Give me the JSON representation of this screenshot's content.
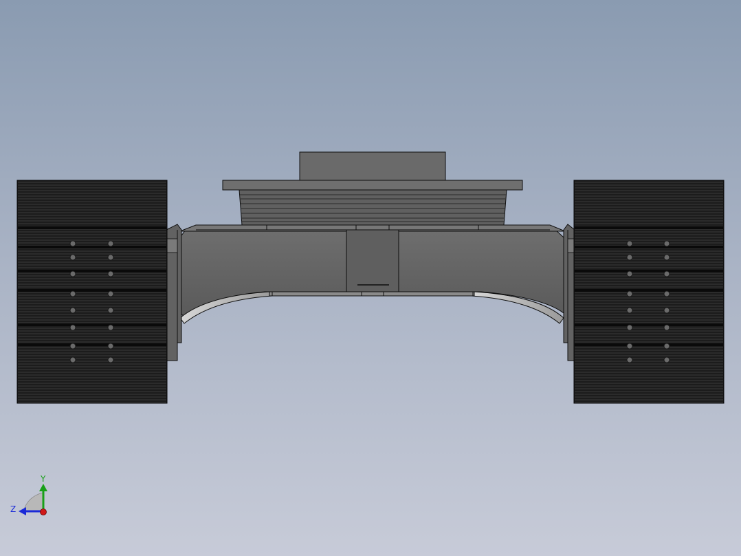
{
  "viewport": {
    "background_top": "#8a9bb1",
    "background_bottom": "#c7cbd8"
  },
  "model": {
    "body_color": "#666666",
    "track_color": "#1c1c1c",
    "edge_color": "#0b0b0b"
  },
  "triad": {
    "y_label": "Y",
    "z_label": "Z",
    "y_color": "#18a018",
    "z_color": "#1a2ad8",
    "x_color": "#d01818"
  }
}
